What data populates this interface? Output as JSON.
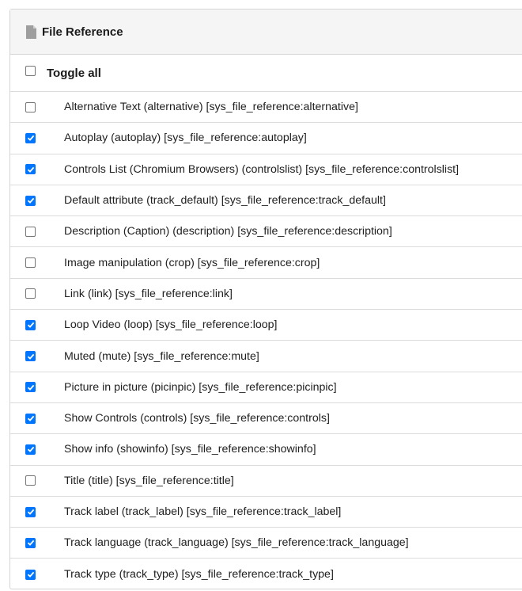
{
  "panel": {
    "title": "File Reference",
    "header_icon": "document-icon"
  },
  "toggle_all": {
    "label": "Toggle all",
    "checked": false
  },
  "fields": [
    {
      "label": "Alternative Text (alternative) [sys_file_reference:alternative]",
      "checked": false
    },
    {
      "label": "Autoplay (autoplay) [sys_file_reference:autoplay]",
      "checked": true
    },
    {
      "label": "Controls List (Chromium Browsers) (controlslist) [sys_file_reference:controlslist]",
      "checked": true
    },
    {
      "label": "Default attribute (track_default) [sys_file_reference:track_default]",
      "checked": true
    },
    {
      "label": "Description (Caption) (description) [sys_file_reference:description]",
      "checked": false
    },
    {
      "label": "Image manipulation (crop) [sys_file_reference:crop]",
      "checked": false
    },
    {
      "label": "Link (link) [sys_file_reference:link]",
      "checked": false
    },
    {
      "label": "Loop Video (loop) [sys_file_reference:loop]",
      "checked": true
    },
    {
      "label": "Muted (mute) [sys_file_reference:mute]",
      "checked": true
    },
    {
      "label": "Picture in picture (picinpic) [sys_file_reference:picinpic]",
      "checked": true
    },
    {
      "label": "Show Controls (controls) [sys_file_reference:controls]",
      "checked": true
    },
    {
      "label": "Show info (showinfo) [sys_file_reference:showinfo]",
      "checked": true
    },
    {
      "label": "Title (title) [sys_file_reference:title]",
      "checked": false
    },
    {
      "label": "Track label (track_label) [sys_file_reference:track_label]",
      "checked": true
    },
    {
      "label": "Track language (track_language) [sys_file_reference:track_language]",
      "checked": true
    },
    {
      "label": "Track type (track_type) [sys_file_reference:track_type]",
      "checked": true
    }
  ],
  "colors": {
    "checkbox_checked": "#0075ff",
    "header_background": "#f5f5f5",
    "border": "#d4d4d4"
  }
}
